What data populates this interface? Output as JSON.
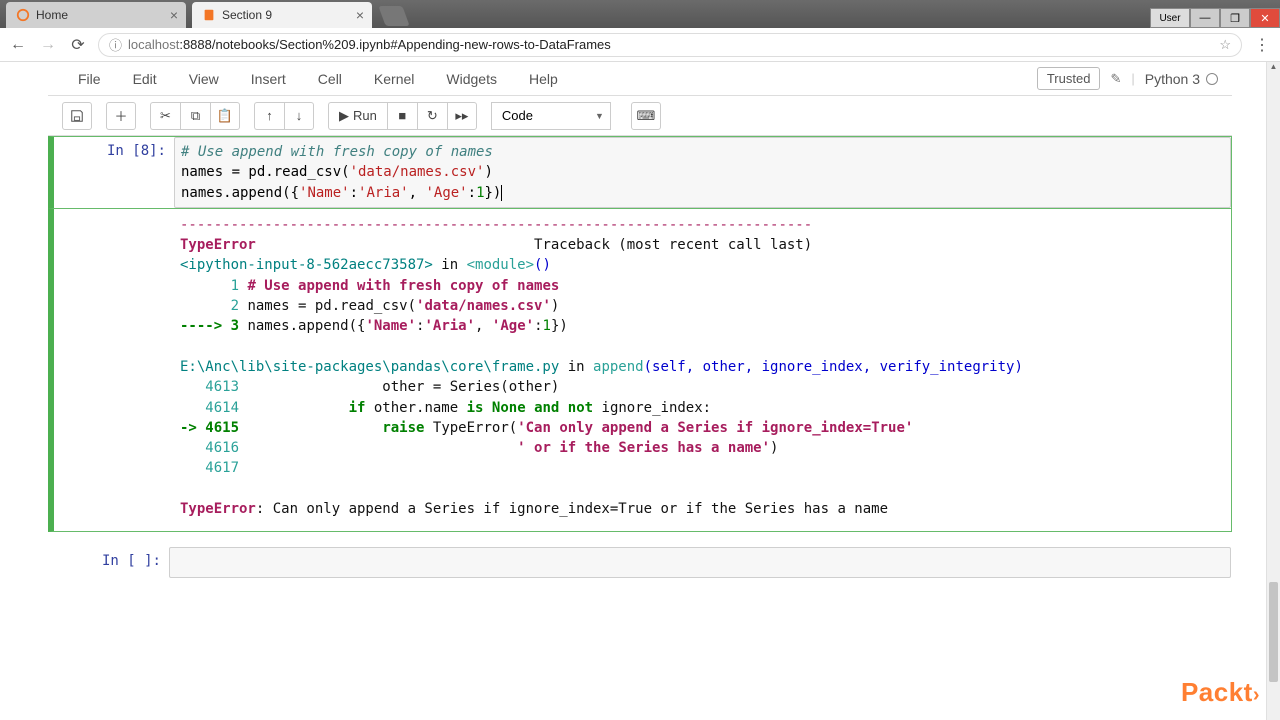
{
  "browser": {
    "tabs": [
      {
        "title": "Home",
        "active": false,
        "favcolor": "#f37626"
      },
      {
        "title": "Section 9",
        "active": true,
        "favcolor": "#f37626"
      }
    ],
    "winuser": "User",
    "url_prefix": "localhost",
    "url_rest": ":8888/notebooks/Section%209.ipynb#Appending-new-rows-to-DataFrames"
  },
  "menu": {
    "items": [
      "File",
      "Edit",
      "View",
      "Insert",
      "Cell",
      "Kernel",
      "Widgets",
      "Help"
    ],
    "trusted": "Trusted",
    "kernel": "Python 3"
  },
  "toolbar": {
    "run": "Run",
    "celltype": "Code"
  },
  "cells": {
    "input_prompt": "In [8]:",
    "code_line1_comment": "# Use append with fresh copy of names",
    "code_line2_a": "names = pd.read_csv(",
    "code_line2_b": "'data/names.csv'",
    "code_line2_c": ")",
    "code_line3_a": "names.append({",
    "code_line3_b": "'Name'",
    "code_line3_c": ":",
    "code_line3_d": "'Aria'",
    "code_line3_e": ", ",
    "code_line3_f": "'Age'",
    "code_line3_g": ":",
    "code_line3_h": "1",
    "code_line3_i": "})",
    "empty_prompt": "In [ ]:"
  },
  "traceback": {
    "sep": "---------------------------------------------------------------------------",
    "errname": "TypeError",
    "traceback_label": "Traceback (most recent call last)",
    "loc1_a": "<ipython-input-8-562aecc73587>",
    "loc1_b": " in ",
    "loc1_c": "<module>",
    "loc1_d": "()",
    "l1_no": "      1 ",
    "l1_txt": "# Use append with fresh copy of names",
    "l2_no": "      2 ",
    "l2_txt_a": "names = pd.read_csv(",
    "l2_txt_b": "'data/names.csv'",
    "l2_txt_c": ")",
    "l3_arrow": "----> 3 ",
    "l3_txt_a": "names.append({",
    "l3_txt_b": "'Name'",
    "l3_txt_c": ":",
    "l3_txt_d": "'Aria'",
    "l3_txt_e": ", ",
    "l3_txt_f": "'Age'",
    "l3_txt_g": ":",
    "l3_txt_h": "1",
    "l3_txt_i": "})",
    "frame_a": "E:\\Anc\\lib\\site-packages\\pandas\\core\\frame.py",
    "frame_b": " in ",
    "frame_c": "append",
    "frame_d": "(self, other, ignore_index, verify_integrity)",
    "f1_no": "   4613",
    "f1_txt": "                 other = Series(other)",
    "f2_no": "   4614",
    "f2_txt_a": "             ",
    "f2_txt_b": "if",
    "f2_txt_c": " other.name ",
    "f2_txt_d": "is",
    "f2_txt_e": " ",
    "f2_txt_f": "None",
    "f2_txt_g": " ",
    "f2_txt_h": "and",
    "f2_txt_i": " ",
    "f2_txt_j": "not",
    "f2_txt_k": " ignore_index:",
    "f3_arrow": "-> 4615",
    "f3_txt_a": "                 ",
    "f3_txt_b": "raise",
    "f3_txt_c": " TypeError(",
    "f3_txt_d": "'Can only append a Series if ignore_index=True'",
    "f4_no": "   4616",
    "f4_txt_a": "                                 ",
    "f4_txt_b": "' or if the Series has a name'",
    "f4_txt_c": ")",
    "f5_no": "   4617",
    "final_err": "TypeError",
    "final_msg": ": Can only append a Series if ignore_index=True or if the Series has a name"
  },
  "brand": "Packt",
  "brand_arr": "›"
}
